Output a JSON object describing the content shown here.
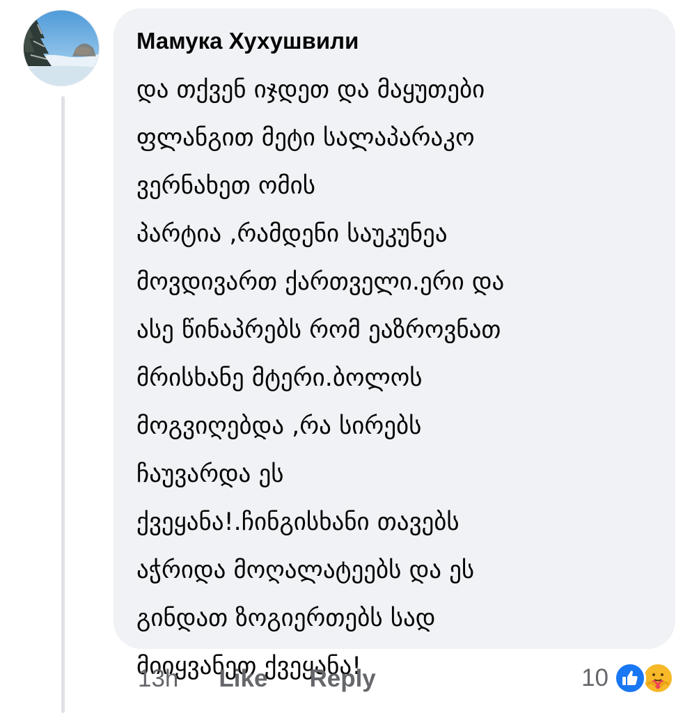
{
  "comment": {
    "author": "Мамука Хухушвили",
    "lines": [
      "და თქვენ იჯდეთ და მაყუთები",
      "ფლანგით მეტი სალაპარაკო",
      "ვერნახეთ ომის",
      "პარტია ,რამდენი საუკუნეა",
      "მოვდივართ ქართველი.ერი და",
      "ასე წინაპრებს რომ ეაზროვნათ",
      "მრისხანე მტერი.ბოლოს",
      "მოგვიღებდა ,რა სირებს",
      "ჩაუვარდა ეს",
      "ქვეყანა!.ჩინგისხანი თავებს",
      "აჭრიდა მოღალატეებს და ეს",
      "გინდათ ზოგიერთებს სად",
      "მიიყვანეთ ქვეყანა!"
    ]
  },
  "actions": {
    "timestamp": "13h",
    "like_label": "Like",
    "reply_label": "Reply"
  },
  "reactions": {
    "count": "10",
    "icons": [
      "like-icon",
      "care-icon"
    ],
    "like_color": "#1877f2",
    "care_color": "#f7b928"
  },
  "colors": {
    "bubble_bg": "#f0f2f5",
    "text": "#050505",
    "meta_text": "#65676b"
  }
}
